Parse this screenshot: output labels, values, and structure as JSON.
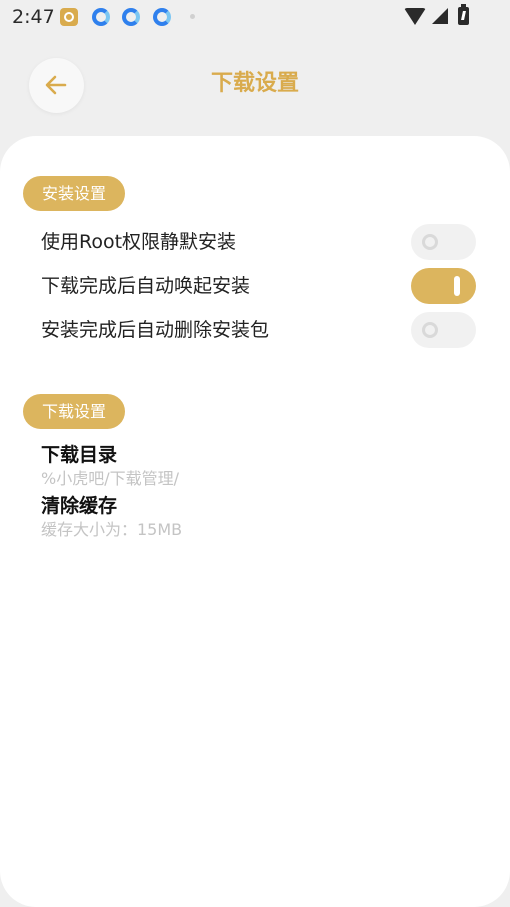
{
  "status_bar": {
    "time": "2:47",
    "icons": [
      "app-notification-icon",
      "edge-browser-icon",
      "edge-browser-icon",
      "edge-browser-icon",
      "dot-icon",
      "wifi-icon",
      "signal-icon",
      "battery-charging-icon"
    ]
  },
  "header": {
    "back_icon": "arrow-left-icon",
    "title": "下载设置"
  },
  "colors": {
    "accent": "#dcb55e",
    "title": "#d9ab4d",
    "toggle_off": "#f1f1f1"
  },
  "install_section": {
    "badge": "安装设置",
    "items": [
      {
        "label": "使用Root权限静默安装",
        "enabled": false
      },
      {
        "label": "下载完成后自动唤起安装",
        "enabled": true
      },
      {
        "label": "安装完成后自动删除安装包",
        "enabled": false
      }
    ]
  },
  "download_section": {
    "badge": "下载设置",
    "items": [
      {
        "title": "下载目录",
        "subtitle": "%小虎吧/下载管理/"
      },
      {
        "title": "清除缓存",
        "subtitle": "缓存大小为：15MB"
      }
    ]
  }
}
